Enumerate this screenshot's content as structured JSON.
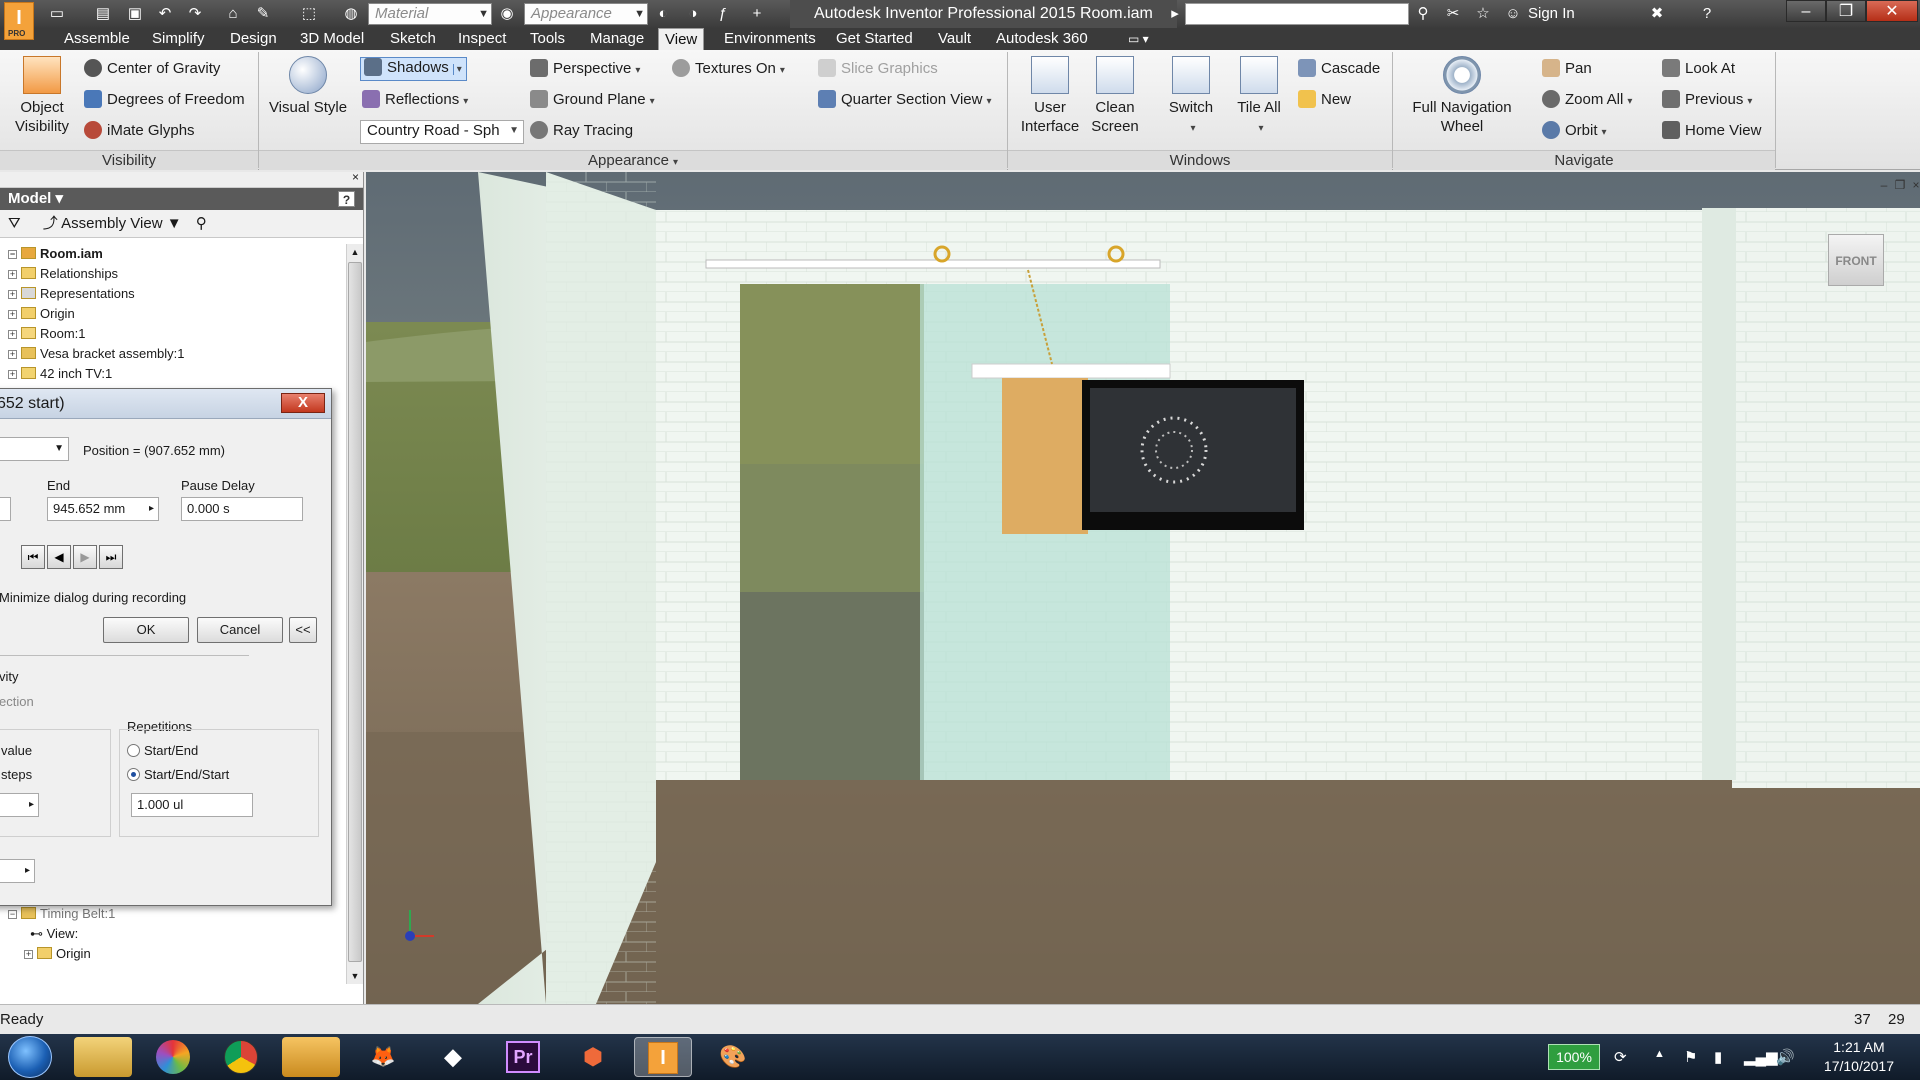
{
  "titlebar": {
    "logo_text": "I",
    "logo_sub": "PRO",
    "material_placeholder": "Material",
    "appearance_placeholder": "Appearance",
    "title": "Autodesk Inventor Professional 2015    Room.iam",
    "sign_in": "Sign In"
  },
  "tabs": [
    "Assemble",
    "Simplify",
    "Design",
    "3D Model",
    "Sketch",
    "Inspect",
    "Tools",
    "Manage",
    "View",
    "Environments",
    "Get Started",
    "Vault",
    "Autodesk 360"
  ],
  "active_tab": "View",
  "ribbon": {
    "visibility": {
      "object_visibility": "Object Visibility",
      "center_of_gravity": "Center of Gravity",
      "degrees_of_freedom": "Degrees of Freedom",
      "imate_glyphs": "iMate Glyphs",
      "label": "Visibility"
    },
    "appearance": {
      "visual_style": "Visual Style",
      "shadows": "Shadows",
      "reflections": "Reflections",
      "environment": "Country Road - Sph",
      "perspective": "Perspective",
      "ground_plane": "Ground Plane",
      "ray_tracing": "Ray Tracing",
      "textures_on": "Textures On",
      "slice_graphics": "Slice Graphics",
      "quarter_section_view": "Quarter Section View",
      "label": "Appearance"
    },
    "windows": {
      "user_interface": "User Interface",
      "clean_screen": "Clean Screen",
      "switch": "Switch",
      "tile_all": "Tile All",
      "cascade": "Cascade",
      "new": "New",
      "label": "Windows"
    },
    "navigate": {
      "full_navigation_wheel": "Full Navigation Wheel",
      "pan": "Pan",
      "zoom_all": "Zoom All",
      "orbit": "Orbit",
      "look_at": "Look At",
      "previous": "Previous",
      "home_view": "Home View",
      "label": "Navigate"
    }
  },
  "browser": {
    "header": "Model",
    "view": "Assembly View",
    "items": [
      {
        "label": "Room.iam"
      },
      {
        "label": "Relationships"
      },
      {
        "label": "Representations"
      },
      {
        "label": "Origin"
      },
      {
        "label": "Room:1"
      },
      {
        "label": "Vesa bracket assembly:1"
      },
      {
        "label": "42 inch TV:1"
      },
      {
        "label": "Timing Belt:1"
      },
      {
        "label": "View:"
      },
      {
        "label": "Origin"
      }
    ]
  },
  "dialog": {
    "title": "652 start)",
    "position": "Position = (907.652 mm)",
    "end_label": "End",
    "end_value": "945.652 mm",
    "pause_label": "Pause Delay",
    "pause_value": "0.000 s",
    "minimize": "Minimize dialog during recording",
    "ok": "OK",
    "cancel": "Cancel",
    "collapse": "<<",
    "activity": "vity",
    "direction": "ection",
    "value": "value",
    "steps": "steps",
    "repetitions_label": "Repetitions",
    "start_end": "Start/End",
    "start_end_start": "Start/End/Start",
    "repetitions_value": "1.000 ul"
  },
  "viewport": {
    "viewcube_label": "FRONT"
  },
  "status": {
    "text": "Ready",
    "count1": "37",
    "count2": "29"
  },
  "taskbar": {
    "battery": "100%",
    "time": "1:21 AM",
    "date": "17/10/2017"
  }
}
